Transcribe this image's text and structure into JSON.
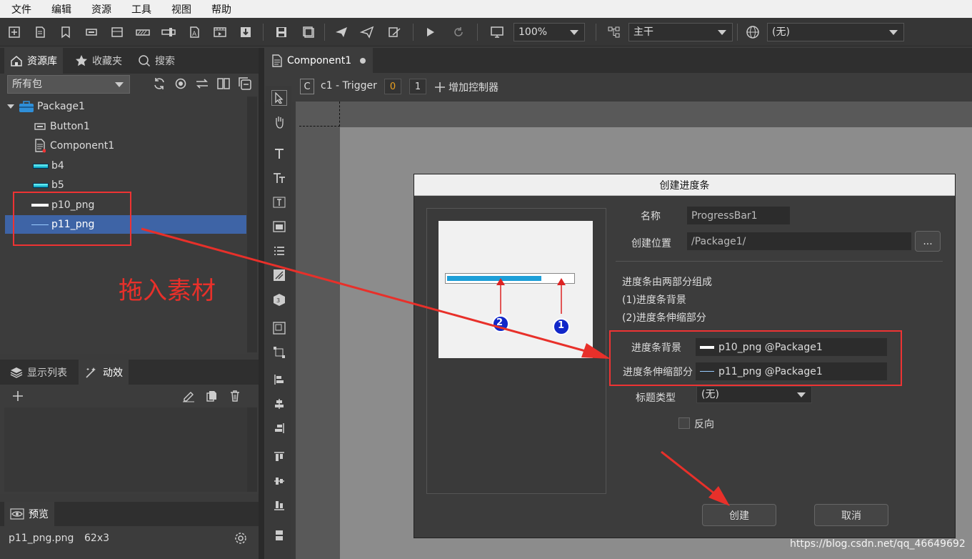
{
  "menu": [
    "文件",
    "编辑",
    "资源",
    "工具",
    "视图",
    "帮助"
  ],
  "toolbar": {
    "zoom": "100%",
    "branch": "主干",
    "language": "(无)"
  },
  "left": {
    "tabs": [
      "资源库",
      "收藏夹",
      "搜索"
    ],
    "package_filter": "所有包",
    "tree": {
      "package": "Package1",
      "items": [
        "Button1",
        "Component1",
        "b4",
        "b5",
        "p10_png",
        "p11_png"
      ]
    },
    "annotation": "拖入素材",
    "bottom_tabs": [
      "显示列表",
      "动效"
    ],
    "preview_tab": "预览",
    "preview_file": "p11_png.png",
    "preview_size": "62x3"
  },
  "doc_tab": "Component1",
  "controller": {
    "badge": "C",
    "name": "c1 - Trigger",
    "page0": "0",
    "page1": "1",
    "add_label": "增加控制器"
  },
  "dialog": {
    "title": "创建进度条",
    "name_label": "名称",
    "name_value": "ProgressBar1",
    "location_label": "创建位置",
    "location_value": "/Package1/",
    "browse_label": "...",
    "desc": [
      "进度条由两部分组成",
      "(1)进度条背景",
      "(2)进度条伸缩部分"
    ],
    "bg_label": "进度条背景",
    "bg_value": "p10_png @Package1",
    "stretch_label": "进度条伸缩部分",
    "stretch_value": "p11_png @Package1",
    "title_type_label": "标题类型",
    "title_type_value": "(无)",
    "reverse_label": "反向",
    "create_button": "创建",
    "cancel_button": "取消",
    "marker1": "1",
    "marker2": "2"
  },
  "watermark": "https://blog.csdn.net/qq_46649692",
  "colors": {
    "accent_red": "#e8302a",
    "selection": "#3e64a6",
    "progress": "#1e9fd8"
  }
}
